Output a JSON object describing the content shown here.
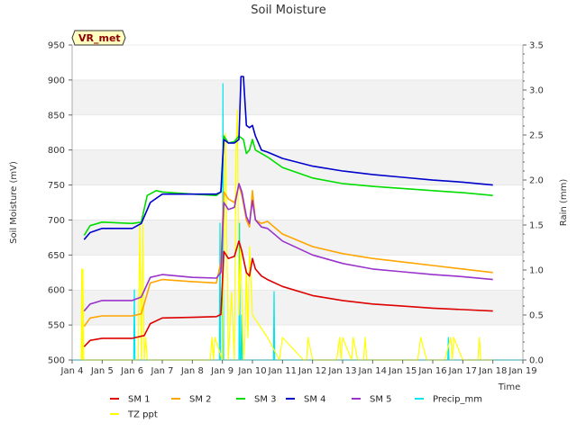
{
  "chart_data": {
    "type": "line",
    "title": "Soil Moisture",
    "xlabel": "Time",
    "ylabel": "Soil Moisture (mV)",
    "y2label": "Rain (mm)",
    "badge": "VR_met",
    "xlim": [
      4,
      19
    ],
    "ylim": [
      500,
      950
    ],
    "y2lim": [
      0,
      3.5
    ],
    "x_ticks": [
      4,
      5,
      6,
      7,
      8,
      9,
      10,
      11,
      12,
      13,
      14,
      15,
      16,
      17,
      18,
      19
    ],
    "x_tick_labels": [
      "Jan 4",
      "Jan 5",
      "Jan 6",
      "Jan 7",
      "Jan 8",
      "Jan 9",
      "Jan 10",
      "Jan 11",
      "Jan 12",
      "Jan 13",
      "Jan 14",
      "Jan 15",
      "Jan 16",
      "Jan 17",
      "Jan 18",
      "Jan 19"
    ],
    "y_ticks": [
      500,
      550,
      600,
      650,
      700,
      750,
      800,
      850,
      900,
      950
    ],
    "y2_ticks": [
      0.0,
      0.5,
      1.0,
      1.5,
      2.0,
      2.5,
      3.0,
      3.5
    ],
    "y2_tick_labels": [
      "0.0",
      "0.5",
      "1.0",
      "1.5",
      "2.0",
      "2.5",
      "3.0",
      "3.5"
    ],
    "grid": "horizontal bands",
    "legend_position": "bottom",
    "series": [
      {
        "name": "SM 1",
        "color": "#dd0000",
        "axis": "left",
        "x": [
          4.4,
          4.6,
          5.0,
          6.0,
          6.4,
          6.6,
          7.0,
          8.0,
          8.8,
          8.95,
          9.05,
          9.2,
          9.4,
          9.55,
          9.65,
          9.8,
          9.9,
          10.0,
          10.1,
          10.3,
          10.5,
          11,
          12,
          13,
          14,
          15,
          16,
          17,
          18.0
        ],
        "y": [
          519,
          528,
          531,
          531,
          535,
          552,
          560,
          561,
          562,
          565,
          655,
          645,
          648,
          670,
          655,
          625,
          620,
          645,
          630,
          620,
          615,
          605,
          592,
          585,
          580,
          577,
          574,
          572,
          570
        ]
      },
      {
        "name": "SM 2",
        "color": "#ffa500",
        "axis": "left",
        "x": [
          4.4,
          4.6,
          5.0,
          6.0,
          6.3,
          6.6,
          7.0,
          8.0,
          8.8,
          8.95,
          9.05,
          9.2,
          9.4,
          9.55,
          9.65,
          9.8,
          9.9,
          10.0,
          10.1,
          10.3,
          10.5,
          11,
          12,
          13,
          14,
          15,
          16,
          17,
          18.0
        ],
        "y": [
          548,
          560,
          563,
          563,
          566,
          610,
          615,
          612,
          610,
          640,
          740,
          730,
          725,
          750,
          735,
          700,
          690,
          742,
          700,
          695,
          698,
          680,
          662,
          652,
          645,
          640,
          635,
          630,
          625
        ]
      },
      {
        "name": "SM 3",
        "color": "#00dd00",
        "axis": "left",
        "x": [
          4.4,
          4.6,
          5.0,
          6.0,
          6.3,
          6.5,
          6.8,
          7.0,
          8.0,
          8.8,
          8.95,
          9.05,
          9.2,
          9.4,
          9.55,
          9.7,
          9.8,
          9.9,
          10.0,
          10.1,
          10.3,
          10.5,
          11,
          12,
          13,
          14,
          15,
          16,
          17,
          18.0
        ],
        "y": [
          678,
          692,
          697,
          695,
          697,
          735,
          742,
          740,
          737,
          735,
          740,
          820,
          810,
          812,
          820,
          815,
          795,
          800,
          815,
          800,
          795,
          790,
          775,
          760,
          752,
          748,
          745,
          742,
          739,
          735
        ]
      },
      {
        "name": "SM 4",
        "color": "#0000cc",
        "axis": "left",
        "x": [
          4.4,
          4.6,
          5.0,
          6.0,
          6.3,
          6.6,
          7.0,
          8.0,
          8.8,
          8.95,
          9.05,
          9.2,
          9.4,
          9.55,
          9.62,
          9.7,
          9.8,
          9.9,
          10.0,
          10.1,
          10.3,
          10.5,
          11,
          12,
          13,
          14,
          15,
          16,
          17,
          18.0
        ],
        "y": [
          672,
          682,
          688,
          688,
          695,
          725,
          737,
          737,
          737,
          740,
          815,
          810,
          810,
          815,
          905,
          905,
          835,
          832,
          835,
          820,
          800,
          797,
          788,
          777,
          770,
          765,
          761,
          757,
          754,
          750
        ]
      },
      {
        "name": "SM 5",
        "color": "#9933cc",
        "axis": "left",
        "x": [
          4.4,
          4.6,
          5.0,
          6.0,
          6.3,
          6.6,
          7.0,
          8.0,
          8.8,
          8.95,
          9.05,
          9.2,
          9.4,
          9.55,
          9.65,
          9.8,
          9.9,
          10.0,
          10.1,
          10.3,
          10.5,
          11,
          12,
          13,
          14,
          15,
          16,
          17,
          18.0
        ],
        "y": [
          570,
          580,
          585,
          585,
          590,
          618,
          622,
          618,
          617,
          625,
          725,
          715,
          718,
          752,
          740,
          705,
          695,
          728,
          700,
          690,
          688,
          670,
          650,
          638,
          630,
          626,
          622,
          619,
          615
        ]
      },
      {
        "name": "Precip_mm",
        "color": "#00e5ee",
        "axis": "right",
        "x": [
          4.0,
          6.05,
          6.07,
          6.09,
          8.9,
          8.92,
          8.94,
          9.0,
          9.02,
          9.04,
          9.55,
          9.57,
          9.59,
          9.62,
          9.64,
          9.66,
          10.7,
          10.72,
          10.74,
          16.5,
          16.52,
          16.54,
          19.0
        ],
        "y": [
          0,
          0,
          0.78,
          0,
          0,
          1.52,
          0,
          0,
          3.07,
          0,
          0,
          1.52,
          0,
          0,
          0.5,
          0,
          0,
          0.76,
          0,
          0,
          0.25,
          0,
          0
        ]
      },
      {
        "name": "TZ ppt",
        "color": "#ffff00",
        "axis": "right",
        "x": [
          4.3,
          4.32,
          4.34,
          4.36,
          4.38,
          6.2,
          6.25,
          6.3,
          6.35,
          6.4,
          6.45,
          6.5,
          8.6,
          8.65,
          8.7,
          8.75,
          9.0,
          9.1,
          9.2,
          9.3,
          9.4,
          9.45,
          9.5,
          9.55,
          9.6,
          9.7,
          9.75,
          9.8,
          9.85,
          9.9,
          10.0,
          10.5,
          10.9,
          11.0,
          11.7,
          11.8,
          11.85,
          12.0,
          12.8,
          12.9,
          12.95,
          13.0,
          13.3,
          13.35,
          13.5,
          13.7,
          13.75,
          13.8,
          14.0,
          14.8,
          15.0,
          15.4,
          15.5,
          15.6,
          15.8,
          16.2,
          16.4,
          16.6,
          16.65,
          16.7,
          17.0,
          17.2,
          17.4,
          17.5,
          17.55,
          17.6,
          18.0
        ],
        "y": [
          0,
          1.01,
          0,
          1.01,
          0,
          0,
          1.51,
          0,
          1.51,
          0,
          0.25,
          0,
          0,
          0.25,
          0,
          0.25,
          0,
          2.52,
          0,
          0.75,
          0,
          2.27,
          2.78,
          0.5,
          1.26,
          0,
          0.25,
          1.01,
          0.25,
          1.26,
          0.5,
          0.25,
          0,
          0.25,
          0,
          0,
          0.25,
          0,
          0,
          0.25,
          0,
          0.25,
          0,
          0.25,
          0,
          0,
          0.25,
          0,
          0,
          0,
          0,
          0,
          0,
          0.25,
          0,
          0,
          0,
          0.25,
          0,
          0.25,
          0,
          0,
          0,
          0,
          0.25,
          0,
          0
        ]
      }
    ]
  }
}
